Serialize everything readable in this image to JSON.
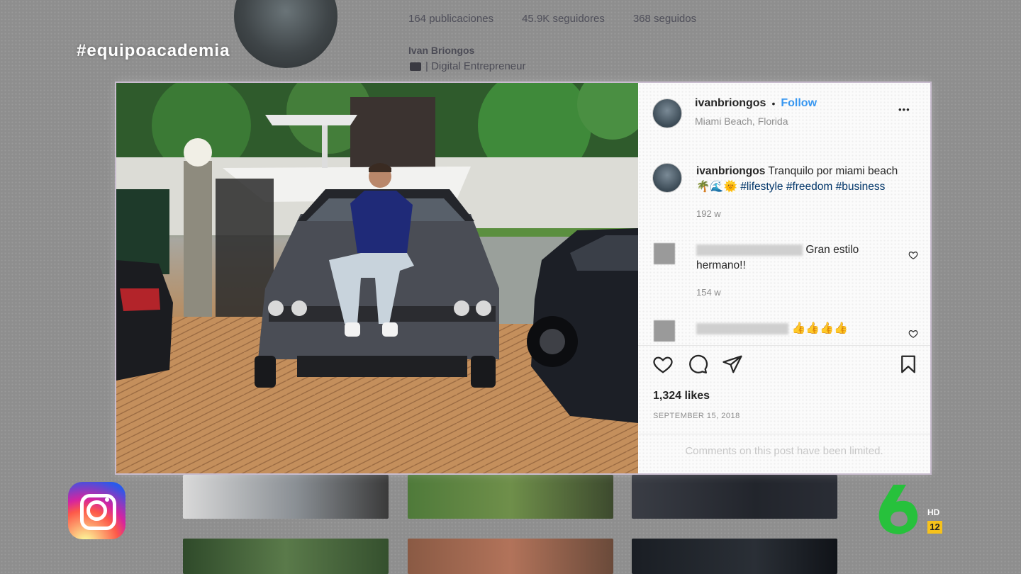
{
  "overlay": {
    "hashtag": "#equipoacademia"
  },
  "profile": {
    "posts": "164 publicaciones",
    "followers": "45.9K seguidores",
    "following": "368 seguidos",
    "name": "Ivan Briongos",
    "bio": "| Digital Entrepreneur"
  },
  "post": {
    "username": "ivanbriongos",
    "separator": "•",
    "follow_label": "Follow",
    "location": "Miami Beach, Florida",
    "more_label": "•••",
    "caption": {
      "username": "ivanbriongos",
      "text": "Tranquilo por miami beach",
      "emojis": "🌴🌊🌞",
      "hashtags": "#lifestyle #freedom #business",
      "age": "192 w"
    },
    "comments": [
      {
        "text": "Gran estilo hermano!!",
        "age": "154 w"
      },
      {
        "text": "👍👍👍👍"
      }
    ],
    "likes": "1,324 likes",
    "date": "SEPTEMBER 15, 2018",
    "limited_notice": "Comments on this post have been limited."
  },
  "icons": [
    "heart-icon",
    "comment-icon",
    "share-icon",
    "bookmark-icon",
    "more-options-icon",
    "instagram-logo",
    "lasexta-logo"
  ],
  "branding": {
    "channel_badge": "HD",
    "channel_number": "12"
  },
  "colors": {
    "follow": "#3897f0",
    "text": "#262626",
    "muted": "#8e8e8e",
    "background": "#8e8e8e"
  }
}
